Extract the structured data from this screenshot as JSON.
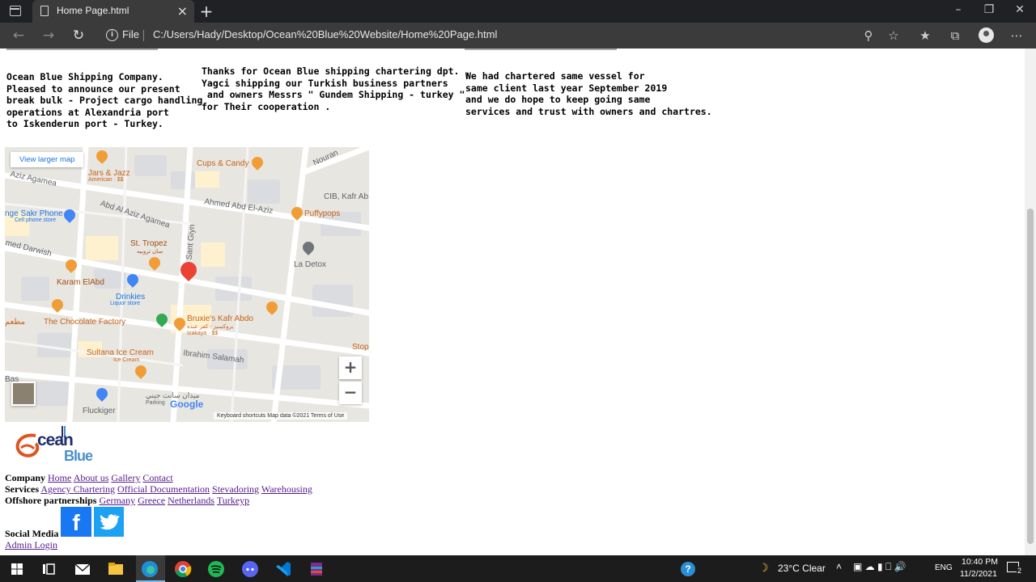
{
  "browser": {
    "tab_title": "Home Page.html",
    "new_tab": "+",
    "close_tab": "×",
    "file_label": "File",
    "url": "C:/Users/Hady/Desktop/Ocean%20Blue%20Website/Home%20Page.html"
  },
  "content": {
    "col1": "Ocean Blue Shipping Company.\nPleased to announce our present\nbreak bulk - Project cargo handling\noperations at Alexandria port\nto Iskenderun port - Turkey.",
    "col2": "Thanks for Ocean Blue shipping chartering dpt. ,\nYagci shipping our Turkish business partners\n and owners Messrs \" Gundem Shipping - turkey \"\nfor Their cooperation .",
    "col3": "We had chartered same vessel for\nsame client last year September 2019\nand we do hope to keep going same\nservices and trust with owners and chartres."
  },
  "map": {
    "view_larger": "View larger map",
    "labels": {
      "nouran": "Nouran",
      "jars": "Jars & Jazz",
      "jars_sub": "American · $$",
      "cups": "Cups & Candy",
      "aziz_agamea": "Aziz Agamea",
      "cib": "CIB, Kafr Ab",
      "ahmed_abd": "Ahmed Abd El-Aziz",
      "puffypops": "Puffypops",
      "sakr": "nge Sakr Phone",
      "sakr_sub": "Cell phone store",
      "abd_al_aziz": "Abd Al Aziz Agamea",
      "st_tropez": "St. Tropez",
      "st_tropez_ar": "سان تروبيه",
      "sant_gyn": "Sant Giyn",
      "med_darwish": "med Darwish",
      "la_detox": "La Detox",
      "karam": "Karam ElAbd",
      "drinkies": "Drinkies",
      "drinkies_sub": "Liquor store",
      "ar_left": "مطعم",
      "chocolate": "The Chocolate Factory",
      "bruxies": "Bruxie's Kafr Abdo",
      "bruxies_ar": "بروكسيز - كفر عبده",
      "bruxies_sub": "Izakaya · $$",
      "ibrahim": "Ibrahim Salamah",
      "stop": "Stop",
      "sultana": "Sultana Ice Cream",
      "sultana_sub": "Ice Cream",
      "bas": "Bas",
      "fluckiger": "Fluckiger",
      "maydan_ar": "ميدان سانت جيني",
      "parking": "Parking"
    },
    "google": "Google",
    "zoom_in": "+",
    "zoom_out": "−",
    "footer": "Keyboard shortcuts    Map data ©2021    Terms of Use"
  },
  "footer": {
    "logo_text1": "cean",
    "logo_text2": "Blue",
    "company_label": "Company",
    "company_links": [
      "Home",
      "About us",
      "Gallery",
      "Contact"
    ],
    "services_label": "Services",
    "services_links": [
      "Agency Chartering",
      "Official Documentation",
      "Stevadoring",
      "Warehousing"
    ],
    "offshore_label": "Offshore partnerships",
    "offshore_links": [
      "Germany",
      "Greece",
      "Netherlands",
      "Turkeyp"
    ],
    "social_label": "Social Media",
    "facebook_glyph": "f",
    "admin_login": "Admin Login"
  },
  "taskbar": {
    "weather": "23°C  Clear",
    "lang": "ENG",
    "time": "10:40 PM",
    "date": "11/2/2021",
    "notif_count": "2"
  },
  "colors": {
    "facebook": "#1877f2",
    "twitter": "#1da1f2",
    "link": "#551a8b",
    "map_marker": "#ea4335"
  }
}
